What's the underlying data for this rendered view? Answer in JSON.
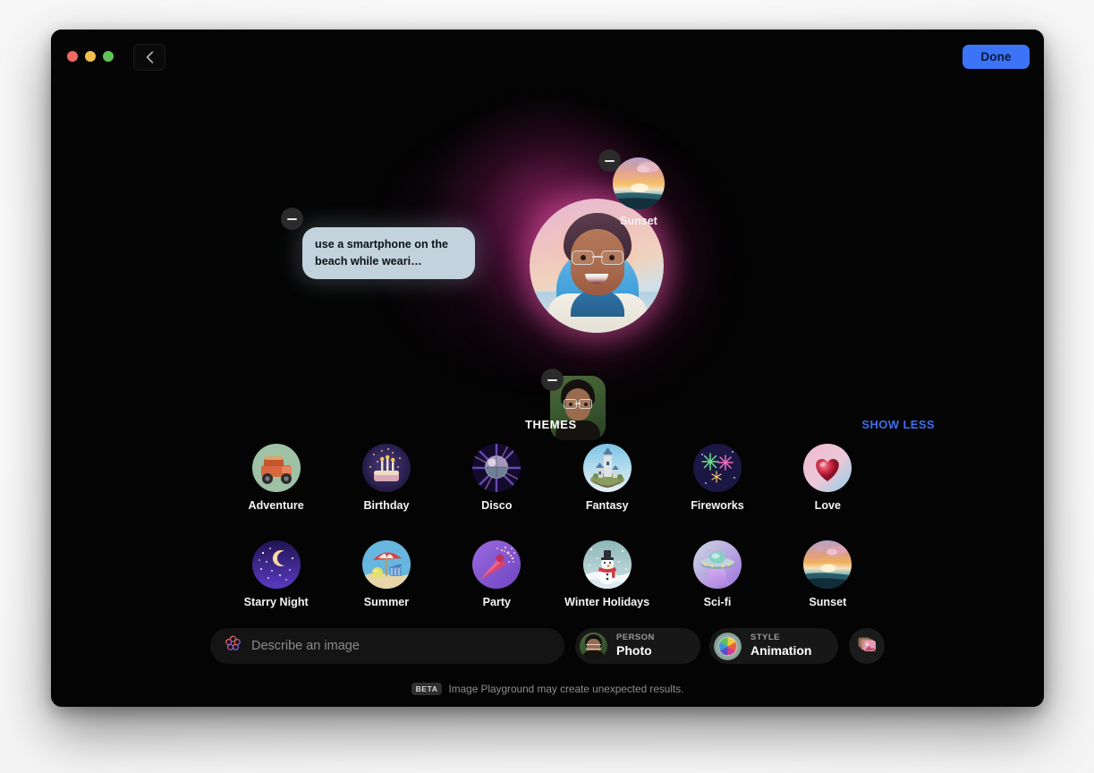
{
  "window": {
    "traffic_lights": [
      "close",
      "minimize",
      "zoom"
    ],
    "back_button_icon": "chevron-left-icon",
    "done_label": "Done"
  },
  "canvas": {
    "prompt_chip": {
      "text": "use a smartphone on the beach while weari…",
      "remove_icon": "minus-icon"
    },
    "tokens": [
      {
        "name": "Sunset",
        "type": "theme",
        "remove_icon": "minus-icon"
      },
      {
        "name": "Person photo",
        "type": "person",
        "remove_icon": "minus-icon"
      }
    ],
    "generated_image_alt": "Animated-style portrait of a boy with glasses in a spacesuit on a sunset beach"
  },
  "themes": {
    "title": "THEMES",
    "show_less_label": "SHOW LESS",
    "accent_color": "#3e6ef0",
    "items": [
      {
        "label": "Adventure",
        "icon": "adventure-icon"
      },
      {
        "label": "Birthday",
        "icon": "birthday-icon"
      },
      {
        "label": "Disco",
        "icon": "disco-icon"
      },
      {
        "label": "Fantasy",
        "icon": "fantasy-icon"
      },
      {
        "label": "Fireworks",
        "icon": "fireworks-icon"
      },
      {
        "label": "Love",
        "icon": "love-icon"
      },
      {
        "label": "Starry Night",
        "icon": "starry-night-icon"
      },
      {
        "label": "Summer",
        "icon": "summer-icon"
      },
      {
        "label": "Party",
        "icon": "party-icon"
      },
      {
        "label": "Winter Holidays",
        "icon": "winter-holidays-icon"
      },
      {
        "label": "Sci-fi",
        "icon": "scifi-icon"
      },
      {
        "label": "Sunset",
        "icon": "sunset-icon"
      }
    ]
  },
  "bottom_bar": {
    "search_placeholder": "Describe an image",
    "search_value": "",
    "search_icon": "apple-intelligence-icon",
    "person": {
      "key": "PERSON",
      "value": "Photo",
      "icon": "person-thumbnail-icon"
    },
    "style": {
      "key": "STYLE",
      "value": "Animation",
      "icon": "color-wheel-icon"
    },
    "photo_picker_icon": "photos-icon"
  },
  "footer": {
    "badge": "BETA",
    "text": "Image Playground may create unexpected results."
  }
}
